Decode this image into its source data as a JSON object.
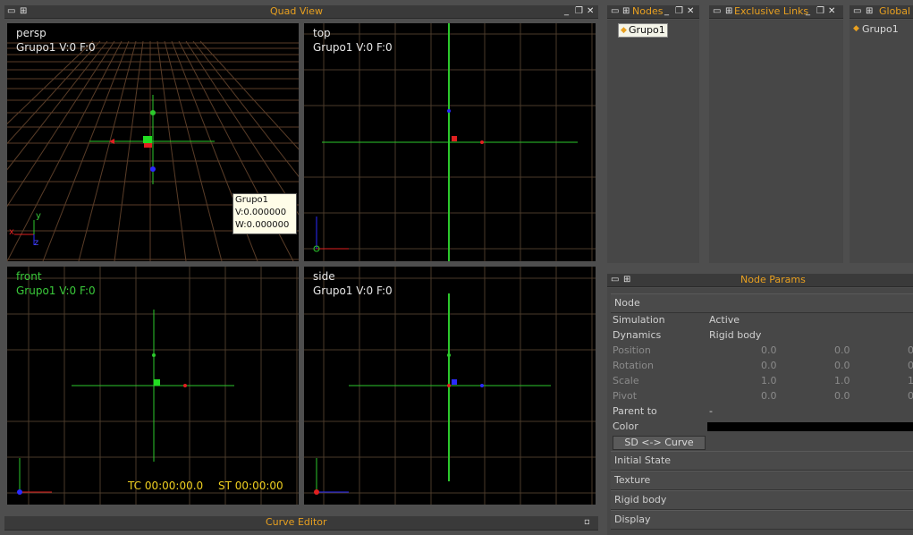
{
  "quad_view": {
    "title": "Quad View",
    "viewports": {
      "persp": {
        "name": "persp",
        "info": "Grupo1  V:0 F:0"
      },
      "top": {
        "name": "top",
        "info": "Grupo1  V:0 F:0"
      },
      "front": {
        "name": "front",
        "info": "Grupo1  V:0 F:0"
      },
      "side": {
        "name": "side",
        "info": "Grupo1  V:0 F:0"
      }
    },
    "tooltip": {
      "line1": "Grupo1",
      "line2": "V:0.000000",
      "line3": "W:0.000000"
    },
    "timecode": {
      "tc": "TC 00:00:00.0",
      "st": "ST 00:00:00"
    },
    "axis_labels": {
      "x": "x",
      "y": "y",
      "z": "z"
    }
  },
  "curve_editor": {
    "title": "Curve Editor"
  },
  "nodes_panel": {
    "title": "Nodes",
    "item": "Grupo1"
  },
  "exclusive_links_panel": {
    "title": "Exclusive Links"
  },
  "global_links_panel": {
    "title": "Global L",
    "item": "Grupo1"
  },
  "node_params": {
    "title": "Node Params",
    "section_node": "Node",
    "rows": {
      "simulation": {
        "label": "Simulation",
        "value": "Active"
      },
      "dynamics": {
        "label": "Dynamics",
        "value": "Rigid body"
      },
      "position": {
        "label": "Position",
        "v1": "0.0",
        "v2": "0.0",
        "v3": "0"
      },
      "rotation": {
        "label": "Rotation",
        "v1": "0.0",
        "v2": "0.0",
        "v3": "0"
      },
      "scale": {
        "label": "Scale",
        "v1": "1.0",
        "v2": "1.0",
        "v3": "1"
      },
      "pivot": {
        "label": "Pivot",
        "v1": "0.0",
        "v2": "0.0",
        "v3": "0"
      },
      "parent_to": {
        "label": "Parent to",
        "value": "-"
      },
      "color": {
        "label": "Color"
      }
    },
    "curve_button": "SD <-> Curve",
    "sections": {
      "initial_state": "Initial State",
      "texture": "Texture",
      "rigid_body": "Rigid body",
      "display": "Display"
    }
  },
  "icons": {
    "window_menu": "window-icon",
    "minimize": "minimize-icon",
    "restore": "restore-icon",
    "close": "close-icon",
    "node": "node-icon"
  },
  "colors": {
    "accent_title": "#e8a020",
    "viewport_bg": "#000000",
    "grid": "#4a3a2a",
    "axis_green": "#2cc82c",
    "axis_red": "#e02020",
    "axis_blue": "#2a2aff"
  }
}
